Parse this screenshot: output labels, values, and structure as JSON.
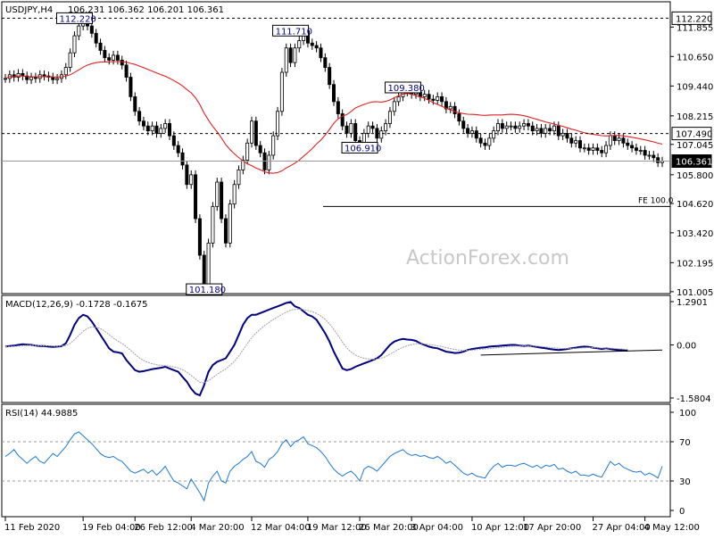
{
  "chart_data": [
    {
      "type": "candlestick",
      "symbol_label": "USDJPY,H4",
      "ohlc_header": "106.231 106.362 106.201 106.361",
      "watermark": "ActionForex.com",
      "ylim": [
        101.0,
        112.6
      ],
      "y_ticks": [
        "111.855",
        "110.650",
        "109.440",
        "108.215",
        "107.045",
        "105.800",
        "104.620",
        "103.420",
        "102.195",
        "101.005"
      ],
      "price_tags": [
        {
          "name": "hline-112",
          "value": 112.22,
          "label": "112.220",
          "dashed": true
        },
        {
          "name": "hline-107",
          "value": 107.49,
          "label": "107.490",
          "dashed": true
        },
        {
          "name": "current",
          "value": 106.361,
          "label": "106.361",
          "dashed": false
        }
      ],
      "fe_level": {
        "value": 104.5,
        "label": "FE 100.0"
      },
      "annotations": [
        {
          "label": "112.220",
          "x": 16,
          "y": 112.22
        },
        {
          "label": "111.710",
          "x": 66,
          "y": 111.71
        },
        {
          "label": "109.380",
          "x": 92,
          "y": 109.38
        },
        {
          "label": "106.910",
          "x": 82,
          "y": 106.91
        },
        {
          "label": "101.180",
          "x": 46,
          "y": 101.18
        }
      ],
      "x_labels": [
        {
          "label": "11 Feb 2020",
          "bar": 0
        },
        {
          "label": "19 Feb 04:00",
          "bar": 18
        },
        {
          "label": "26 Feb 12:00",
          "bar": 30
        },
        {
          "label": "4 Mar 20:00",
          "bar": 43
        },
        {
          "label": "12 Mar 04:00",
          "bar": 57
        },
        {
          "label": "19 Mar 12:00",
          "bar": 70
        },
        {
          "label": "26 Mar 20:00",
          "bar": 82
        },
        {
          "label": "3 Apr 04:00",
          "bar": 94
        },
        {
          "label": "10 Apr 12:00",
          "bar": 108
        },
        {
          "label": "17 Apr 20:00",
          "bar": 120
        },
        {
          "label": "27 Apr 04:00",
          "bar": 136
        },
        {
          "label": "4 May 12:00",
          "bar": 148
        }
      ],
      "close": [
        109.75,
        109.9,
        109.8,
        109.95,
        109.85,
        109.7,
        109.8,
        109.75,
        109.9,
        109.85,
        109.8,
        109.7,
        109.75,
        109.9,
        110.2,
        110.8,
        111.5,
        111.9,
        112.22,
        111.9,
        111.6,
        111.2,
        110.9,
        110.6,
        110.5,
        110.7,
        110.5,
        110.3,
        109.8,
        109.0,
        108.4,
        108.0,
        107.8,
        107.6,
        107.8,
        107.5,
        107.7,
        107.9,
        107.4,
        107.0,
        106.7,
        106.2,
        105.4,
        105.8,
        104.0,
        102.5,
        101.18,
        103.0,
        104.5,
        105.5,
        104.0,
        103.0,
        104.6,
        105.4,
        106.0,
        106.4,
        107.1,
        108.0,
        107.0,
        106.7,
        106.0,
        106.6,
        107.4,
        108.4,
        110.0,
        111.0,
        110.4,
        111.0,
        111.3,
        111.71,
        111.2,
        111.1,
        111.0,
        110.6,
        110.2,
        109.5,
        108.8,
        108.3,
        107.8,
        107.5,
        107.9,
        107.2,
        106.91,
        107.5,
        107.8,
        107.7,
        107.3,
        107.6,
        107.9,
        108.4,
        108.8,
        109.0,
        109.38,
        109.2,
        109.1,
        109.2,
        109.0,
        109.1,
        108.9,
        108.85,
        109.0,
        108.8,
        108.5,
        108.6,
        108.3,
        108.0,
        107.7,
        107.5,
        107.6,
        107.3,
        107.1,
        107.0,
        107.3,
        107.6,
        107.9,
        107.7,
        107.8,
        107.8,
        107.7,
        107.8,
        107.9,
        107.8,
        107.6,
        107.7,
        107.5,
        107.7,
        107.6,
        107.8,
        107.4,
        107.5,
        107.3,
        107.1,
        107.2,
        106.9,
        106.9,
        106.8,
        106.9,
        106.8,
        106.7,
        107.0,
        107.4,
        107.2,
        107.3,
        107.1,
        107.0,
        106.9,
        106.8,
        106.8,
        106.6,
        106.6,
        106.5,
        106.3,
        106.361
      ],
      "ma_period": 30,
      "ma_color": "#e02020"
    },
    {
      "type": "line",
      "title_text": "MACD(12,26,9) -0.1728 -0.1675",
      "ylim": [
        -1.58,
        1.29
      ],
      "y_ticks": [
        "1.2901",
        "0.00",
        "-1.5804"
      ],
      "current_tag": "0.00",
      "macd": [
        -0.05,
        -0.03,
        -0.02,
        0.0,
        0.02,
        0.01,
        0.0,
        -0.02,
        -0.03,
        -0.03,
        -0.05,
        -0.06,
        -0.05,
        -0.04,
        0.05,
        0.3,
        0.6,
        0.8,
        0.9,
        0.85,
        0.7,
        0.5,
        0.3,
        0.1,
        -0.1,
        -0.2,
        -0.22,
        -0.25,
        -0.45,
        -0.6,
        -0.75,
        -0.8,
        -0.78,
        -0.75,
        -0.72,
        -0.7,
        -0.68,
        -0.65,
        -0.7,
        -0.75,
        -0.8,
        -0.95,
        -1.1,
        -1.3,
        -1.45,
        -1.5,
        -1.2,
        -0.8,
        -0.6,
        -0.5,
        -0.45,
        -0.4,
        -0.2,
        0.0,
        0.3,
        0.6,
        0.8,
        0.9,
        0.9,
        0.95,
        1.0,
        1.05,
        1.1,
        1.15,
        1.2,
        1.25,
        1.28,
        1.15,
        1.1,
        1.0,
        0.9,
        0.85,
        0.75,
        0.55,
        0.35,
        0.1,
        -0.2,
        -0.45,
        -0.7,
        -0.75,
        -0.72,
        -0.65,
        -0.6,
        -0.55,
        -0.5,
        -0.45,
        -0.4,
        -0.3,
        -0.15,
        0.0,
        0.1,
        0.15,
        0.18,
        0.16,
        0.15,
        0.12,
        0.05,
        0.0,
        -0.05,
        -0.08,
        -0.1,
        -0.15,
        -0.2,
        -0.22,
        -0.24,
        -0.23,
        -0.2,
        -0.15,
        -0.12,
        -0.1,
        -0.08,
        -0.07,
        -0.05,
        -0.04,
        -0.03,
        -0.02,
        -0.01,
        0.0,
        0.0,
        -0.02,
        -0.03,
        -0.02,
        -0.04,
        -0.06,
        -0.08,
        -0.1,
        -0.12,
        -0.14,
        -0.15,
        -0.14,
        -0.12,
        -0.1,
        -0.08,
        -0.06,
        -0.05,
        -0.06,
        -0.08,
        -0.1,
        -0.12,
        -0.1,
        -0.12,
        -0.14,
        -0.15,
        -0.16,
        -0.1728
      ],
      "signal_period": 9,
      "trend_line": [
        {
          "bar": 110,
          "v": -0.3
        },
        {
          "bar": 152,
          "v": -0.15
        }
      ]
    },
    {
      "type": "line",
      "title_text": "RSI(14) 44.9885",
      "ylim": [
        0,
        100
      ],
      "y_ticks": [
        "100",
        "70",
        "30",
        "0"
      ],
      "levels": [
        70,
        30
      ],
      "rsi": [
        55,
        58,
        62,
        56,
        52,
        48,
        52,
        55,
        50,
        48,
        53,
        58,
        55,
        60,
        65,
        72,
        78,
        80,
        76,
        72,
        68,
        63,
        58,
        55,
        54,
        55,
        52,
        50,
        45,
        40,
        38,
        40,
        42,
        38,
        41,
        36,
        40,
        45,
        37,
        30,
        28,
        25,
        22,
        32,
        25,
        18,
        10,
        28,
        35,
        40,
        30,
        28,
        40,
        45,
        48,
        52,
        55,
        60,
        50,
        48,
        44,
        52,
        55,
        60,
        68,
        72,
        65,
        70,
        72,
        75,
        68,
        66,
        64,
        60,
        55,
        48,
        42,
        38,
        35,
        38,
        40,
        36,
        30,
        42,
        45,
        43,
        40,
        45,
        50,
        55,
        58,
        60,
        62,
        58,
        56,
        57,
        55,
        56,
        54,
        53,
        55,
        52,
        48,
        50,
        46,
        42,
        38,
        36,
        38,
        35,
        34,
        33,
        40,
        45,
        48,
        44,
        46,
        46,
        45,
        47,
        48,
        46,
        44,
        46,
        43,
        46,
        45,
        47,
        42,
        43,
        40,
        38,
        40,
        36,
        36,
        35,
        37,
        35,
        34,
        42,
        50,
        46,
        48,
        44,
        42,
        40,
        39,
        40,
        36,
        38,
        36,
        33,
        44.9885
      ]
    }
  ]
}
